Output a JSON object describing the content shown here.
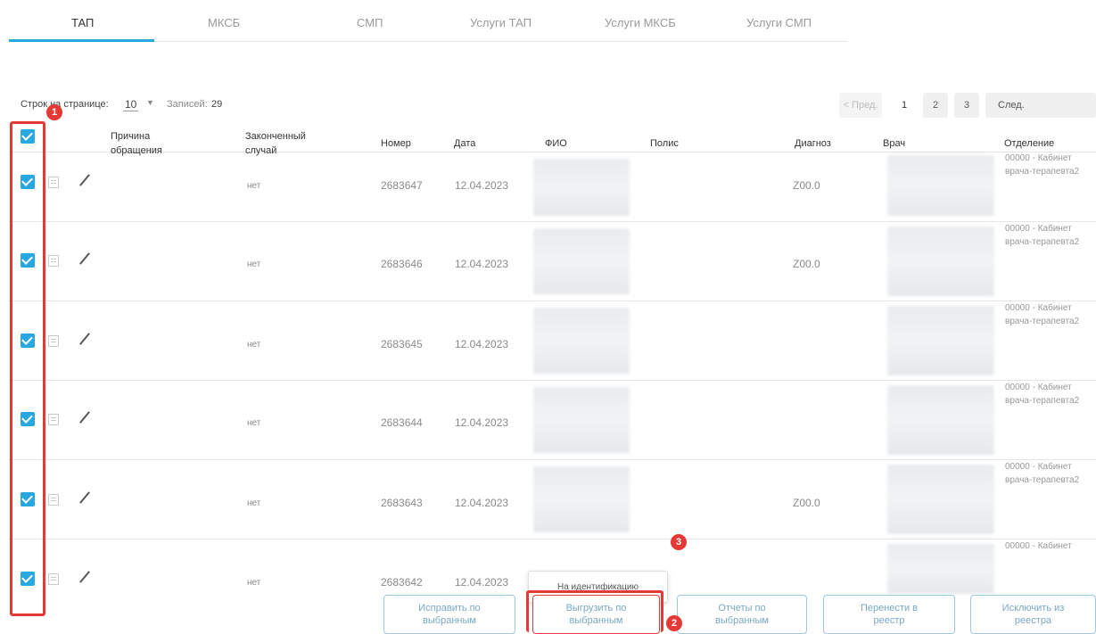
{
  "tabs": [
    "ТАП",
    "МКСБ",
    "СМП",
    "Услуги ТАП",
    "Услуги МКСБ",
    "Услуги СМП"
  ],
  "toolbar": {
    "rows_label": "Строк на странице:",
    "rows_value": "10",
    "records_label": "Записей:",
    "records_value": "29"
  },
  "pagination": {
    "prev": "< Пред.",
    "pages": [
      "1",
      "2",
      "3"
    ],
    "next": "След."
  },
  "headers": {
    "reason": "Причина обращения",
    "finished": "Законченный случай",
    "number": "Номер",
    "date": "Дата",
    "fio": "ФИО",
    "policy": "Полис",
    "diagnosis": "Диагноз",
    "doctor": "Врач",
    "department": "Отделение"
  },
  "rows": [
    {
      "finished": "нет",
      "number": "2683647",
      "date": "12.04.2023",
      "diagnosis": "Z00.0",
      "dept": "00000 - Кабинет врача-терапевта2"
    },
    {
      "finished": "нет",
      "number": "2683646",
      "date": "12.04.2023",
      "diagnosis": "Z00.0",
      "dept": "00000 - Кабинет врача-терапевта2"
    },
    {
      "finished": "нет",
      "number": "2683645",
      "date": "12.04.2023",
      "diagnosis": "",
      "dept": "00000 - Кабинет врача-терапевта2"
    },
    {
      "finished": "нет",
      "number": "2683644",
      "date": "12.04.2023",
      "diagnosis": "",
      "dept": "00000 - Кабинет врача-терапевта2"
    },
    {
      "finished": "нет",
      "number": "2683643",
      "date": "12.04.2023",
      "diagnosis": "Z00.0",
      "dept": "00000 - Кабинет врача-терапевта2"
    },
    {
      "finished": "нет",
      "number": "2683642",
      "date": "12.04.2023",
      "diagnosis": "",
      "dept": "00000 - Кабинет"
    }
  ],
  "popup": {
    "item": "На идентификацию"
  },
  "actions": {
    "fix": "Исправить по выбранным",
    "export": "Выгрузить по выбранным",
    "reports": "Отчеты по выбранным",
    "move": "Перенести в реестр",
    "exclude": "Исключить из реестра"
  },
  "badges": [
    "1",
    "2",
    "3"
  ],
  "colors": {
    "accent": "#29a8e0",
    "annotation": "#e53935",
    "button_border": "#9ac9e3"
  }
}
